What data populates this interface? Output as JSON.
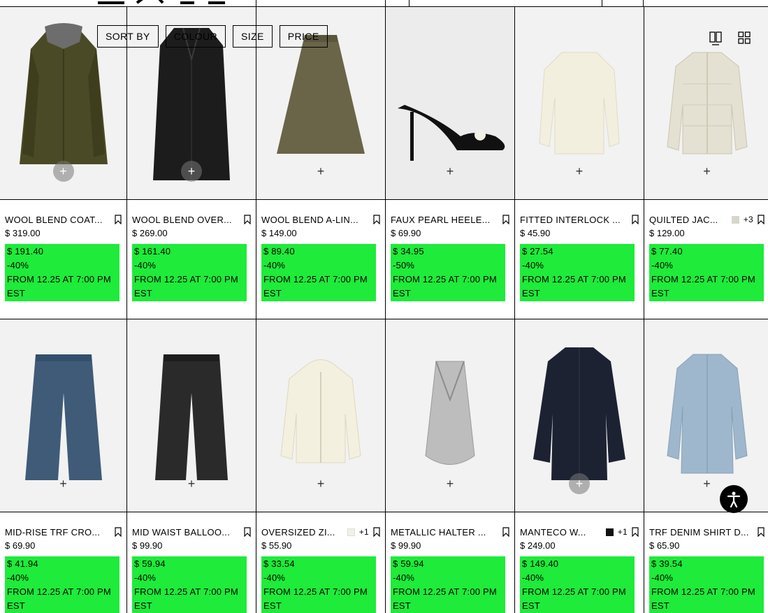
{
  "filters": {
    "sort_by": "SORT BY",
    "colour": "COLOUR",
    "size": "SIZE",
    "price": "PRICE"
  },
  "icons": {
    "add": "plus-icon",
    "bookmark": "bookmark-icon",
    "accessibility": "accessibility-icon",
    "view_single": "single-column-view-icon",
    "view_grid": "grid-view-icon"
  },
  "colors": {
    "promo_bg": "#1eeb3a"
  },
  "products": [
    {
      "name": "WOOL BLEND COAT...",
      "price": "$ 319.00",
      "sale": "$ 191.40",
      "discount": "-40%",
      "promo_text": "FROM 12.25 AT 7:00 PM EST"
    },
    {
      "name": "WOOL BLEND OVER...",
      "price": "$ 269.00",
      "sale": "$ 161.40",
      "discount": "-40%",
      "promo_text": "FROM 12.25 AT 7:00 PM EST"
    },
    {
      "name": "WOOL BLEND A-LIN...",
      "price": "$ 149.00",
      "sale": "$ 89.40",
      "discount": "-40%",
      "promo_text": "FROM 12.25 AT 7:00 PM EST"
    },
    {
      "name": "FAUX PEARL HEELE...",
      "price": "$ 69.90",
      "sale": "$ 34.95",
      "discount": "-50%",
      "promo_text": "FROM 12.25 AT 7:00 PM EST"
    },
    {
      "name": "FITTED INTERLOCK ...",
      "price": "$ 45.90",
      "sale": "$ 27.54",
      "discount": "-40%",
      "promo_text": "FROM 12.25 AT 7:00 PM EST"
    },
    {
      "name": "QUILTED JAC...",
      "more_colors": "+3",
      "swatch_color": "#d8d6cc",
      "price": "$ 129.00",
      "sale": "$ 77.40",
      "discount": "-40%",
      "promo_text": "FROM 12.25 AT 7:00 PM EST"
    },
    {
      "name": "MID-RISE TRF CRO...",
      "price": "$ 69.90",
      "sale": "$ 41.94",
      "discount": "-40%",
      "promo_text": "FROM 12.25 AT 7:00 PM EST"
    },
    {
      "name": "MID WAIST BALLOO...",
      "price": "$ 99.90",
      "sale": "$ 59.94",
      "discount": "-40%",
      "promo_text": "FROM 12.25 AT 7:00 PM EST"
    },
    {
      "name": "OVERSIZED ZI...",
      "more_colors": "+1",
      "swatch_color": "#f1f0e6",
      "price": "$ 55.90",
      "sale": "$ 33.54",
      "discount": "-40%",
      "promo_text": "FROM 12.25 AT 7:00 PM EST"
    },
    {
      "name": "METALLIC HALTER ...",
      "price": "$ 99.90",
      "sale": "$ 59.94",
      "discount": "-40%",
      "promo_text": "FROM 12.25 AT 7:00 PM EST"
    },
    {
      "name": "MANTECO W...",
      "more_colors": "+1",
      "swatch_color": "#111111",
      "price": "$ 249.00",
      "sale": "$ 149.40",
      "discount": "-40%",
      "promo_text": "FROM 12.25 AT 7:00 PM EST"
    },
    {
      "name": "TRF DENIM SHIRT D...",
      "price": "$ 65.90",
      "sale": "$ 39.54",
      "discount": "-40%",
      "promo_text": "FROM 12.25 AT 7:00 PM EST"
    }
  ]
}
